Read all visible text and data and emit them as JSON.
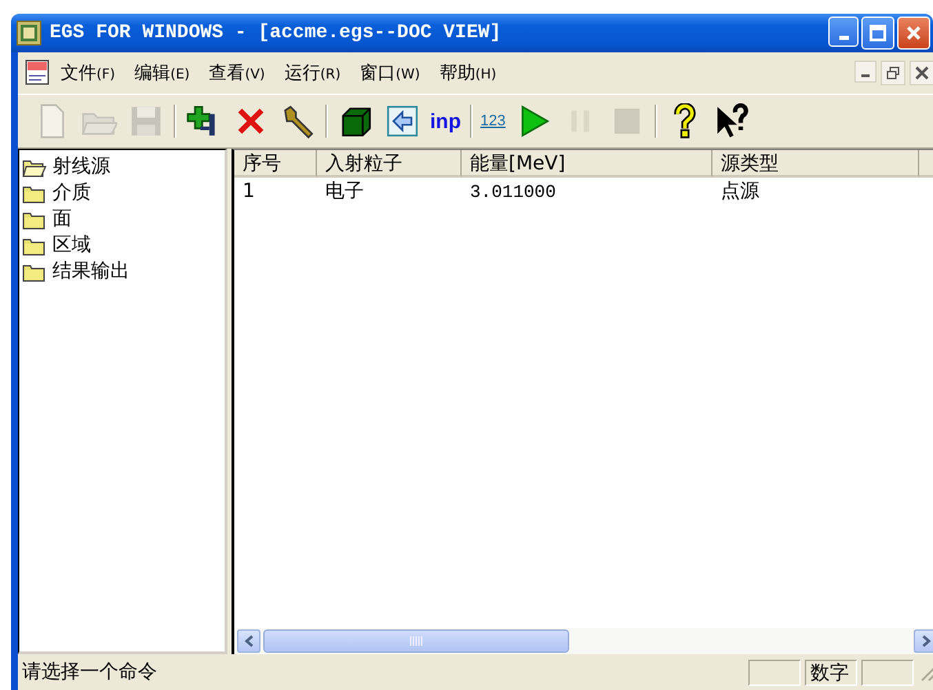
{
  "window": {
    "title": "EGS FOR WINDOWS - [accme.egs--DOC VIEW]"
  },
  "menu": [
    {
      "label": "文件",
      "key": "(F)"
    },
    {
      "label": "编辑",
      "key": "(E)"
    },
    {
      "label": "查看",
      "key": "(V)"
    },
    {
      "label": "运行",
      "key": "(R)"
    },
    {
      "label": "窗口",
      "key": "(W)"
    },
    {
      "label": "帮助",
      "key": "(H)"
    }
  ],
  "toolbar": [
    {
      "kind": "new",
      "disabled": true
    },
    {
      "kind": "open",
      "disabled": true
    },
    {
      "kind": "save",
      "disabled": true
    },
    {
      "kind": "sep"
    },
    {
      "kind": "add",
      "disabled": false
    },
    {
      "kind": "delete",
      "disabled": false
    },
    {
      "kind": "wrench",
      "disabled": false
    },
    {
      "kind": "sep"
    },
    {
      "kind": "cube",
      "disabled": false
    },
    {
      "kind": "arrowbox",
      "disabled": false
    },
    {
      "kind": "text",
      "label": "inp",
      "disabled": false
    },
    {
      "kind": "sep"
    },
    {
      "kind": "numbers",
      "label": "123",
      "disabled": false
    },
    {
      "kind": "play",
      "disabled": false
    },
    {
      "kind": "pause",
      "disabled": true
    },
    {
      "kind": "stop",
      "disabled": true
    },
    {
      "kind": "sep"
    },
    {
      "kind": "help",
      "disabled": false
    },
    {
      "kind": "contexthelp",
      "disabled": false
    }
  ],
  "tree": [
    {
      "label": "射线源",
      "open": true
    },
    {
      "label": "介质",
      "open": false
    },
    {
      "label": "面",
      "open": false
    },
    {
      "label": "区域",
      "open": false
    },
    {
      "label": "结果输出",
      "open": false
    }
  ],
  "table": {
    "columns": [
      "序号",
      "入射粒子",
      "能量[MeV]",
      "源类型"
    ],
    "rows": [
      [
        "1",
        "电子",
        "3.011000",
        "点源"
      ]
    ]
  },
  "status_bar": {
    "message": "请选择一个命令",
    "indicators": [
      "数字"
    ]
  }
}
